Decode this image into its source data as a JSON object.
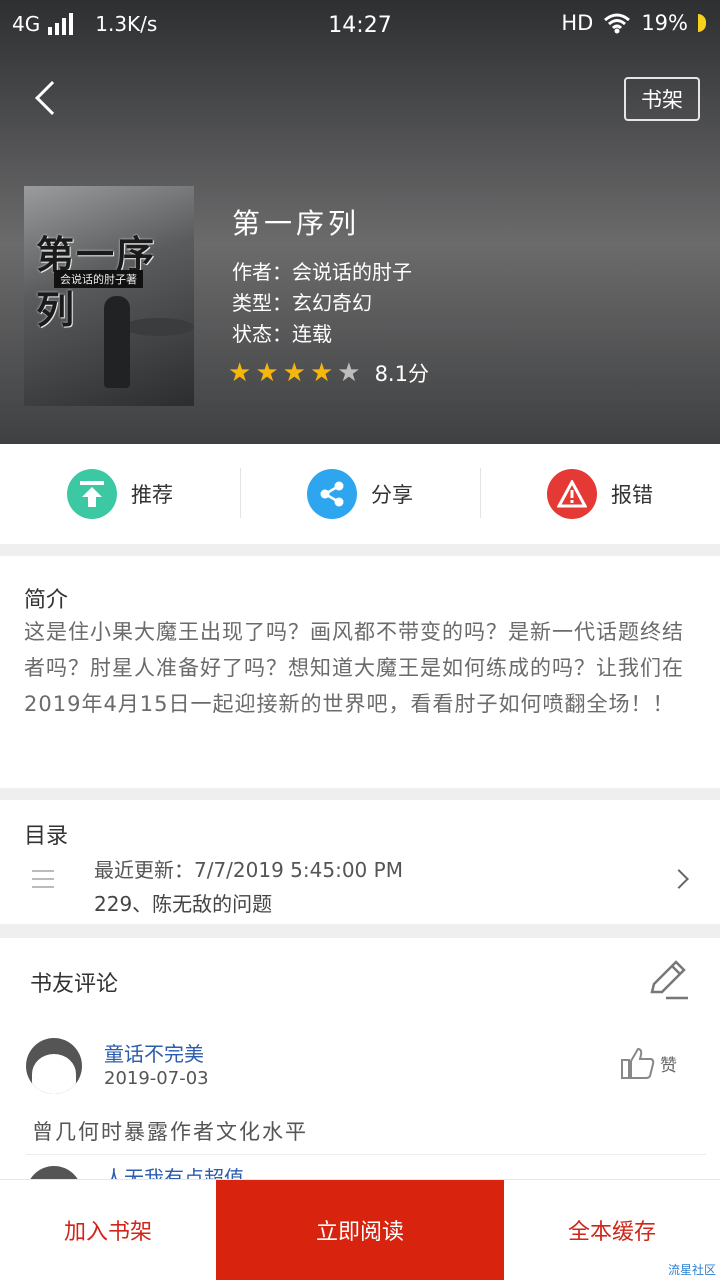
{
  "status_bar": {
    "network": "4G",
    "speed": "1.3K/s",
    "time": "14:27",
    "hd": "HD",
    "battery": "19%"
  },
  "header": {
    "back_icon": "chevron-left-icon",
    "shelf_button": "书架",
    "book": {
      "title": "第一序列",
      "author_label": "作者：",
      "author": "会说话的肘子",
      "genre_label": "类型：",
      "genre": "玄幻奇幻",
      "status_label": "状态：",
      "status": "连载",
      "rating_stars": 4,
      "rating_max": 5,
      "score": "8.1分"
    },
    "cover": {
      "title": "第一序列",
      "subtitle": "会说话的肘子著"
    }
  },
  "actions": [
    {
      "label": "推荐",
      "icon": "upload-arrow-icon",
      "color": "#3cc8a3"
    },
    {
      "label": "分享",
      "icon": "share-icon",
      "color": "#2ea6ef"
    },
    {
      "label": "报错",
      "icon": "warning-icon",
      "color": "#e53935"
    }
  ],
  "intro": {
    "title": "简介",
    "text": "这是住小果大魔王出现了吗？画风都不带变的吗？是新一代话题终结者吗？肘星人准备好了吗？想知道大魔王是如何练成的吗？让我们在2019年4月15日一起迎接新的世界吧，看看肘子如何喷翻全场！！"
  },
  "toc": {
    "title": "目录",
    "latest": "最近更新：7/7/2019 5:45:00 PM",
    "chapter": "229、陈无敌的问题"
  },
  "comments": {
    "title": "书友评论",
    "items": [
      {
        "name": "童话不完美",
        "date": "2019-07-03",
        "text": "曾几何时暴露作者文化水平",
        "like_label": "赞"
      },
      {
        "name": "人无我有点超值",
        "date": "",
        "text": "",
        "like_label": ""
      }
    ]
  },
  "bottom_bar": {
    "add_shelf": "加入书架",
    "read_now": "立即阅读",
    "cache_all": "全本缓存"
  },
  "watermark": "流星社区",
  "colors": {
    "accent_red": "#d8230f",
    "link_blue": "#2a5db0",
    "star": "#f5b70d"
  }
}
